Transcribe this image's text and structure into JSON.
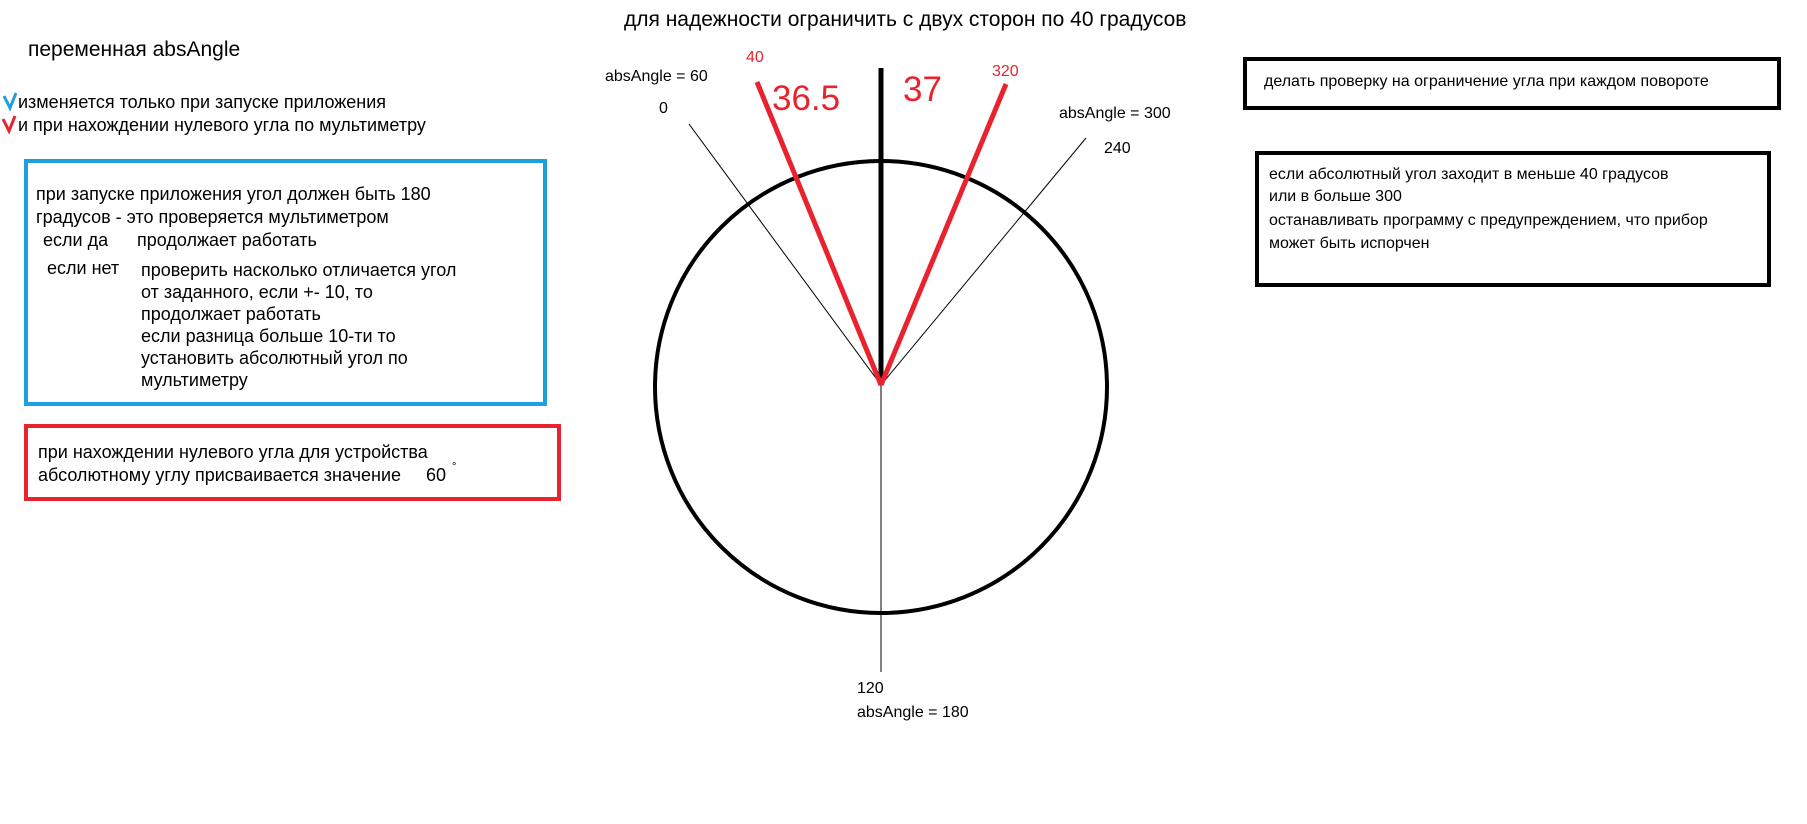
{
  "title": "для надежности ограничить с двух сторон по 40 градусов",
  "variable_heading": "переменная absAngle",
  "change_notes": {
    "line1": "изменяется только при запуске приложения",
    "line2": "и при нахождении нулевого угла по мультиметру",
    "colors": {
      "line1_mark": "#1ea0e0",
      "line2_mark": "#e8232e"
    }
  },
  "blue_box": {
    "line1": "при запуске приложения угол должен быть 180",
    "line2": "градусов  - это проверяется мультиметром",
    "yes_label": "если  да",
    "yes_text": "продолжает работать",
    "no_label": "если нет",
    "no_lines": [
      "проверить насколько отличается угол",
      "от заданного, если +- 10, то",
      "продолжает работать",
      "если разница больше 10-ти то",
      "установить абсолютный угол по",
      "мультиметру"
    ],
    "border_color": "#1ea0e0"
  },
  "red_box": {
    "line1": "при нахождении нулевого угла для устройства",
    "line2": "абсолютному углу присваивается значение",
    "value": "60",
    "degree_mark": "°",
    "border_color": "#e8232e"
  },
  "right_box1": {
    "text": "делать проверку на ограничение угла при каждом повороте"
  },
  "right_box2": {
    "lines": [
      "если абсолютный угол заходит в меньше 40 градусов",
      "или в больше 300",
      "останавливать программу с предупреждением, что прибор",
      "может быть испорчен"
    ]
  },
  "dial": {
    "label_abs60": "absAngle = 60",
    "label_0": "0",
    "label_40": "40",
    "label_365": "36.5",
    "label_37": "37",
    "label_320": "320",
    "label_abs300": "absAngle = 300",
    "label_240": "240",
    "label_120": "120",
    "label_abs180": "absAngle = 180",
    "colors": {
      "limit_lines": "#e8232e",
      "circle": "#000000",
      "center_line": "#000000"
    }
  }
}
